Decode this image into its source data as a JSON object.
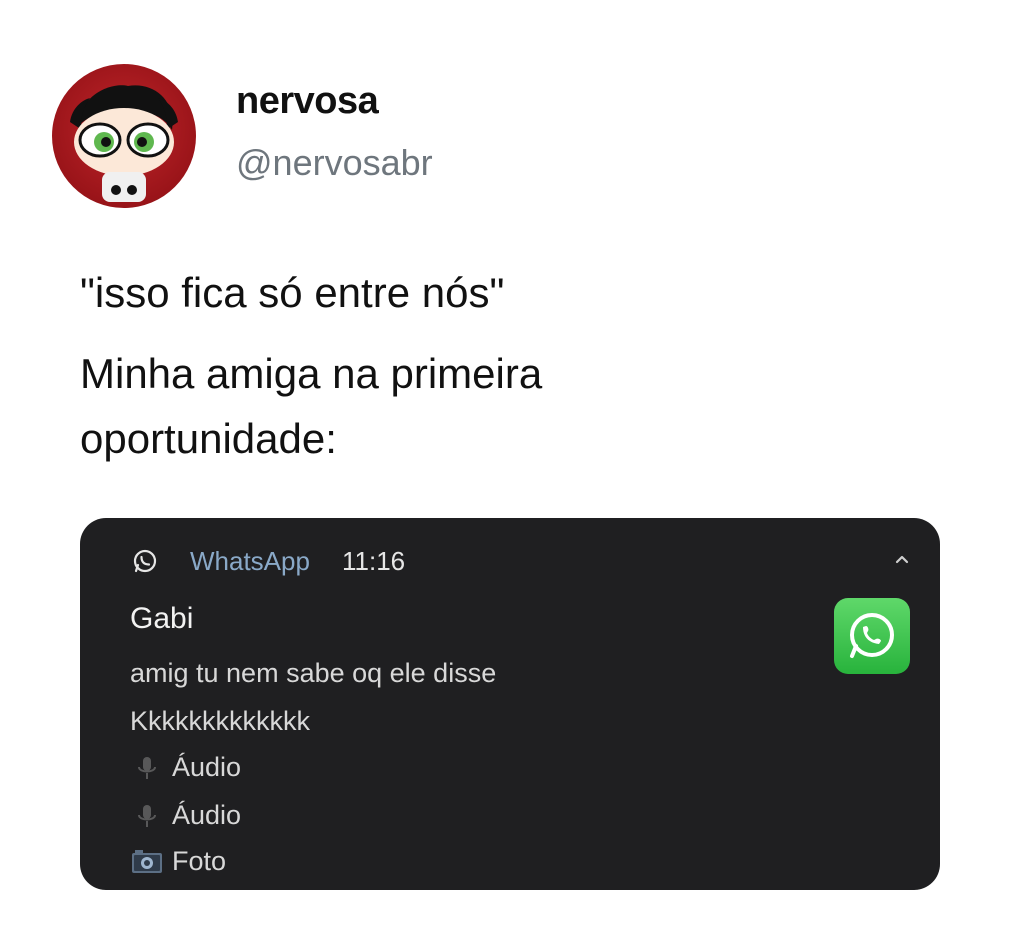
{
  "tweet": {
    "display_name": "nervosa",
    "handle": "@nervosabr",
    "lines": [
      "\"isso fica só entre nós\"",
      "Minha amiga na primeira",
      "oportunidade:"
    ]
  },
  "notification": {
    "app_name": "WhatsApp",
    "time": "11:16",
    "sender": "Gabi",
    "messages": [
      "amig tu nem sabe oq ele disse",
      "Kkkkkkkkkkkkk"
    ],
    "attachments": [
      {
        "icon": "microphone-icon",
        "label": "Áudio"
      },
      {
        "icon": "microphone-icon",
        "label": "Áudio"
      },
      {
        "icon": "camera-icon",
        "label": "Foto"
      }
    ],
    "colors": {
      "background": "#1f1f21",
      "app_name": "#8aa9c8",
      "whatsapp_green": "#28b33c"
    }
  }
}
